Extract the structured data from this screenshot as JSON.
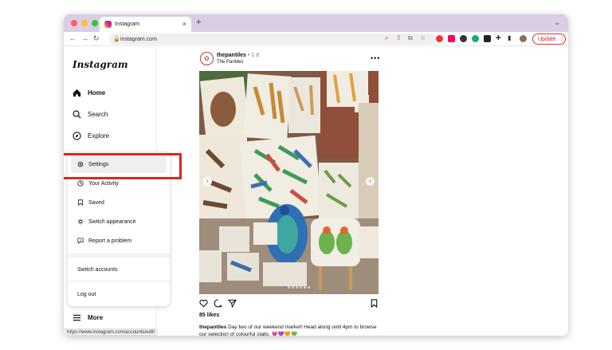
{
  "browser": {
    "tab_title": "Instagram",
    "new_tab": "+",
    "close_tab": "×",
    "url": "instagram.com",
    "update_label": "Update",
    "status_url": "https://www.instagram.com/accounts/edit/"
  },
  "sidebar": {
    "logo": "Instagram",
    "items": [
      {
        "label": "Home",
        "icon": "home-icon"
      },
      {
        "label": "Search",
        "icon": "search-icon"
      },
      {
        "label": "Explore",
        "icon": "compass-icon"
      }
    ],
    "more_label": "More"
  },
  "menu": {
    "items": [
      {
        "label": "Settings",
        "icon": "gear-icon"
      },
      {
        "label": "Your Activity",
        "icon": "activity-icon"
      },
      {
        "label": "Saved",
        "icon": "bookmark-icon"
      },
      {
        "label": "Switch appearance",
        "icon": "sun-icon"
      },
      {
        "label": "Report a problem",
        "icon": "alert-icon"
      }
    ],
    "switch_accounts": "Switch accounts",
    "log_out": "Log out"
  },
  "post": {
    "username": "thepantiles",
    "time": "• 1 d",
    "location": "The Pantiles",
    "likes": "85 likes",
    "caption_user": "thepantiles",
    "caption_text": "Day two of our weekend market! Head along until 4pm to browse our selection of colourful stalls. 💗💜🧡💚"
  },
  "colors": {
    "accent_red": "#e2231a",
    "tabbar": "#dacde4"
  }
}
